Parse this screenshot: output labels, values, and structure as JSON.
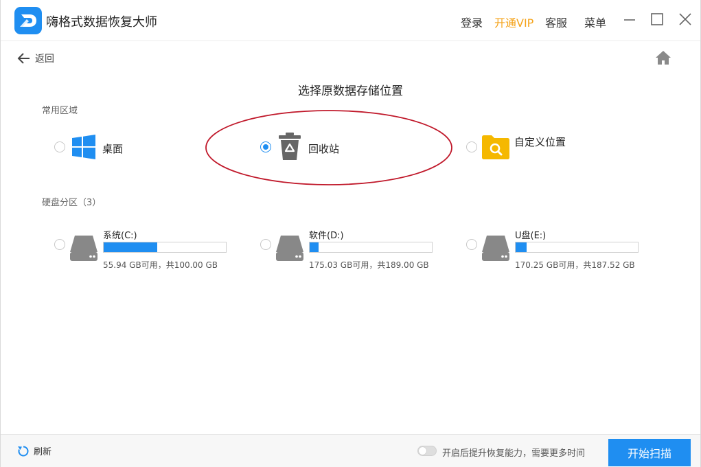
{
  "app": {
    "title": "嗨格式数据恢复大师"
  },
  "topbar": {
    "login": "登录",
    "vip": "开通VIP",
    "service": "客服",
    "menu": "菜单"
  },
  "nav": {
    "back_label": "返回"
  },
  "page": {
    "title": "选择原数据存储位置"
  },
  "common_area": {
    "label": "常用区域",
    "options": [
      {
        "label": "桌面",
        "icon": "windows-icon",
        "selected": false
      },
      {
        "label": "回收站",
        "icon": "recycle-bin-icon",
        "selected": true
      },
      {
        "label": "自定义位置",
        "icon": "folder-search-icon",
        "selected": false
      }
    ]
  },
  "partitions": {
    "label": "硬盘分区（3）",
    "drives": [
      {
        "name": "系统(C:)",
        "info": "55.94 GB可用，共100.00 GB",
        "used_fraction": 0.44
      },
      {
        "name": "软件(D:)",
        "info": "175.03 GB可用，共189.00 GB",
        "used_fraction": 0.074
      },
      {
        "name": "U盘(E:)",
        "info": "170.25 GB可用，共187.52 GB",
        "used_fraction": 0.092
      }
    ]
  },
  "footer": {
    "refresh_label": "刷新",
    "toggle_label": "开启后提升恢复能力，需要更多时间",
    "toggle_on": false,
    "start_label": "开始扫描"
  },
  "colors": {
    "accent": "#1f8ef1",
    "vip": "#f5a31a",
    "annotation": "#c0182a",
    "folder": "#f5b800",
    "windows": "#1f8ef1"
  }
}
